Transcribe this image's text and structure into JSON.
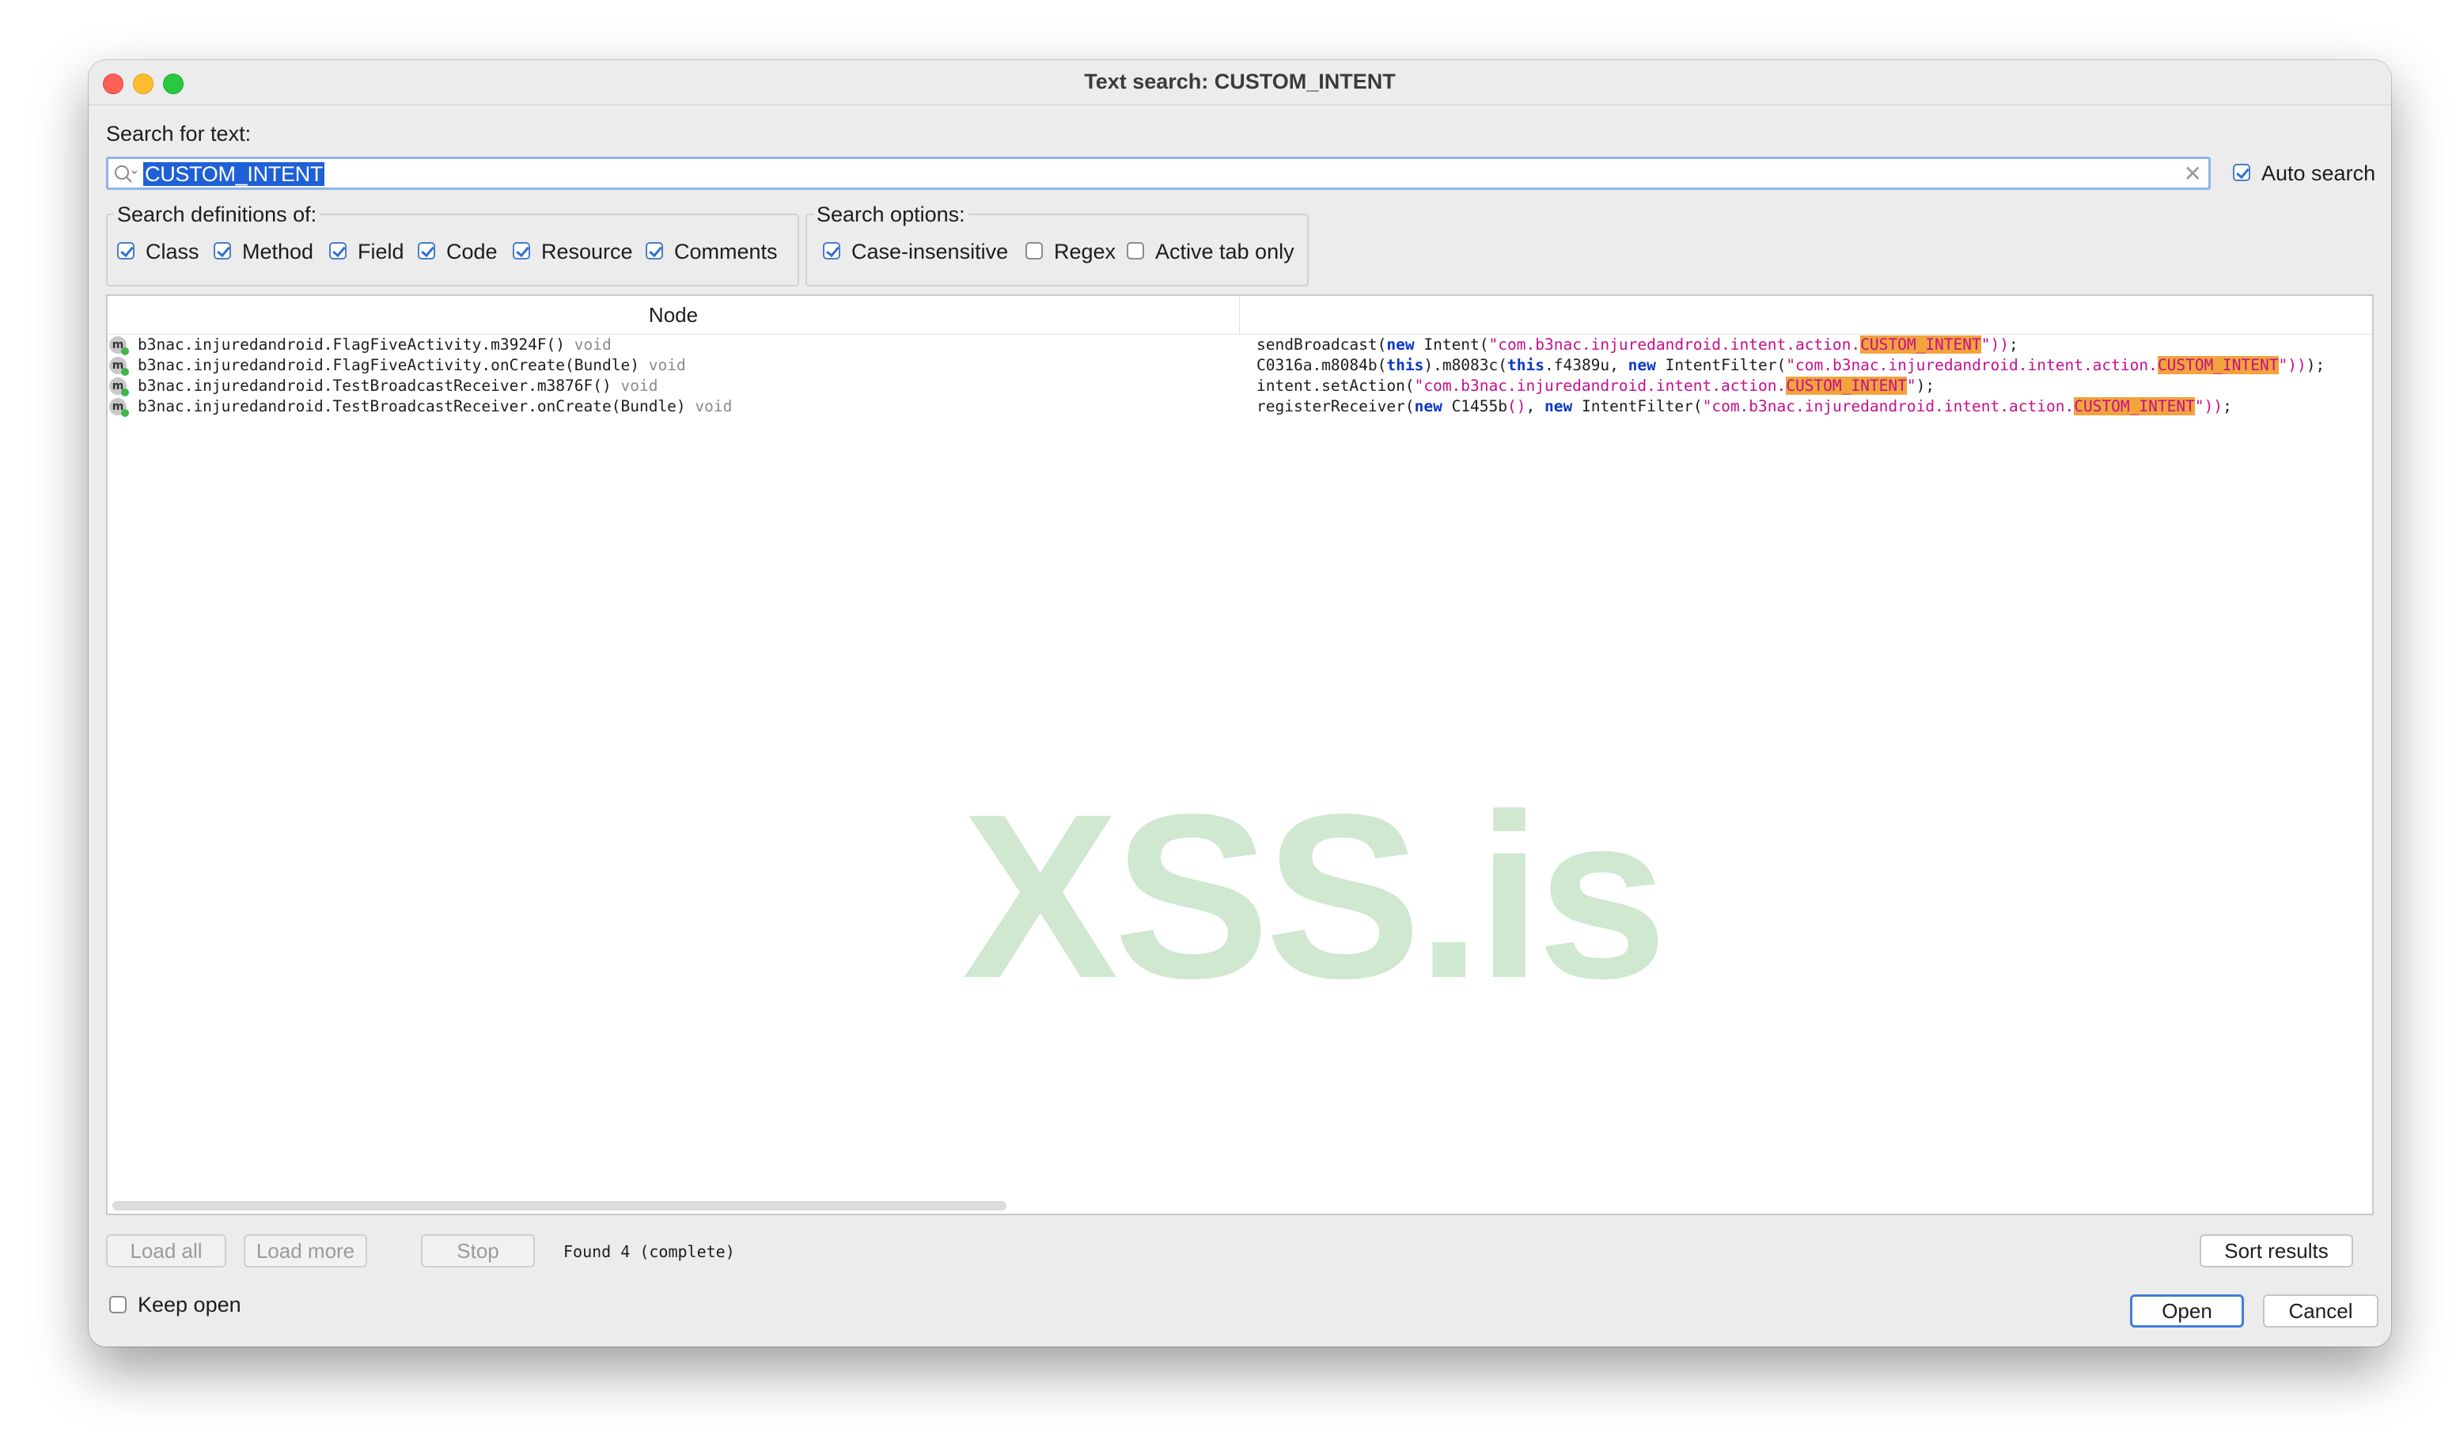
{
  "window": {
    "title": "Text search: CUSTOM_INTENT"
  },
  "search": {
    "label": "Search for text:",
    "value": "CUSTOM_INTENT",
    "auto_search_label": "Auto search",
    "auto_search_checked": true
  },
  "definitions": {
    "title": "Search definitions of:",
    "options": [
      {
        "label": "Class",
        "checked": true
      },
      {
        "label": "Method",
        "checked": true
      },
      {
        "label": "Field",
        "checked": true
      },
      {
        "label": "Code",
        "checked": true
      },
      {
        "label": "Resource",
        "checked": true
      },
      {
        "label": "Comments",
        "checked": true
      }
    ]
  },
  "search_options": {
    "title": "Search options:",
    "options": [
      {
        "label": "Case-insensitive",
        "checked": true
      },
      {
        "label": "Regex",
        "checked": false
      },
      {
        "label": "Active tab only",
        "checked": false
      }
    ]
  },
  "results": {
    "column_node": "Node",
    "rows": [
      {
        "icon": "m",
        "node": "b3nac.injuredandroid.FlagFiveActivity.m3924F()",
        "type": "void",
        "code": {
          "pre": "sendBroadcast(",
          "kw1": "new",
          "mid1": " Intent(",
          "str": "\"com.b3nac.injuredandroid.intent.action.",
          "hl": "CUSTOM_INTENT",
          "str_end": "\"))",
          "post": ";"
        }
      },
      {
        "icon": "m",
        "node": "b3nac.injuredandroid.FlagFiveActivity.onCreate(Bundle)",
        "type": "void",
        "code": {
          "pre": "C0316a.m8084b(",
          "kw0": "this",
          "mid0": ").m8083c(",
          "kw0b": "this",
          "mid0b": ".f4389u, ",
          "kw1": "new",
          "mid1": " IntentFilter(",
          "str": "\"com.b3nac.injuredandroid.intent.action.",
          "hl": "CUSTOM_INTENT",
          "str_end": "\"))",
          "post": ");"
        }
      },
      {
        "icon": "m",
        "node": "b3nac.injuredandroid.TestBroadcastReceiver.m3876F()",
        "type": "void",
        "code": {
          "pre": "intent.setAction(",
          "str": "\"com.b3nac.injuredandroid.intent.action.",
          "hl": "CUSTOM_INTENT",
          "str_end": "\"",
          "post": ");"
        }
      },
      {
        "icon": "m",
        "node": "b3nac.injuredandroid.TestBroadcastReceiver.onCreate(Bundle)",
        "type": "void",
        "code": {
          "pre": "registerReceiver(",
          "kw1": "new",
          "mid1": " C1455b",
          "paren": "()",
          "mid2": ", ",
          "kw2": "new",
          "mid3": " IntentFilter(",
          "str": "\"com.b3nac.injuredandroid.intent.action.",
          "hl": "CUSTOM_INTENT",
          "str_end": "\"))",
          "post": ";"
        }
      }
    ]
  },
  "watermark": "XSS.is",
  "footer": {
    "load_all": "Load all",
    "load_more": "Load more",
    "stop": "Stop",
    "status": "Found 4 (complete)",
    "sort_results": "Sort results",
    "keep_open_label": "Keep open",
    "keep_open_checked": false,
    "open": "Open",
    "cancel": "Cancel"
  },
  "colors": {
    "accent": "#1f60d6",
    "highlight": "#f2a33c",
    "keyword": "#0b38c6",
    "string": "#c40f8f"
  }
}
